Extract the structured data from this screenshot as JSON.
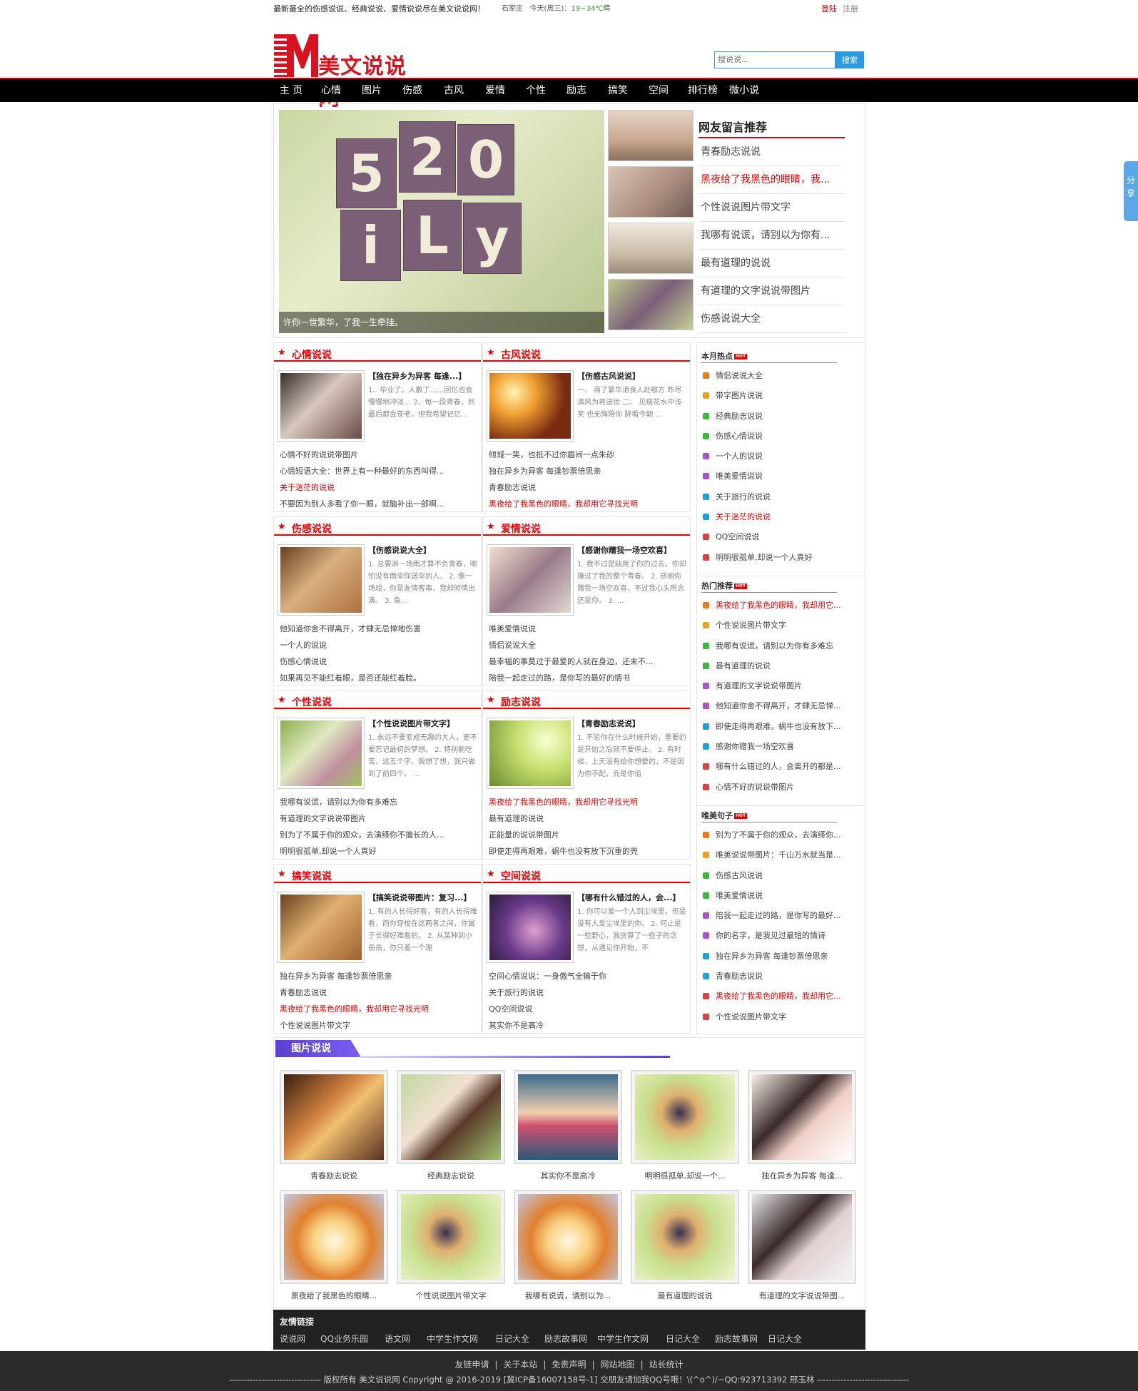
{
  "topbar": {
    "slogan": "最新最全的伤感说说、经典说说、爱情说说尽在美文说说网！",
    "city": "石家庄",
    "weather": "今天(周三)：",
    "temp": "19~34℃",
    "weather_tail": "晴",
    "login": "登陆",
    "register": "注册"
  },
  "logo": {
    "text": "美文说说网"
  },
  "search": {
    "placeholder": "搜说说...",
    "button": "搜索"
  },
  "nav": [
    "主 页",
    "心情",
    "图片",
    "伤感",
    "古风",
    "爱情",
    "个性",
    "励志",
    "搞笑",
    "空间",
    "排行榜",
    "微小说"
  ],
  "slider": {
    "caption": "许你一世繁华，了我一生牵挂。",
    "blocks": [
      "5",
      "2",
      "0",
      "i",
      "L",
      "y"
    ]
  },
  "recommend": {
    "title": "网友留言推荐",
    "items": [
      {
        "text": "青春励志说说",
        "red": false
      },
      {
        "text": "黑夜给了我黑色的眼睛，我...",
        "red": true
      },
      {
        "text": "个性说说图片带文字",
        "red": false
      },
      {
        "text": "我哪有说谎，请别以为你有...",
        "red": false
      },
      {
        "text": "最有道理的说说",
        "red": false
      },
      {
        "text": "有道理的文字说说带图片",
        "red": false
      },
      {
        "text": "伤感说说大全",
        "red": false
      }
    ]
  },
  "categories": [
    {
      "title": "心情说说",
      "head": "【独在异乡为异客 每逢...】",
      "excerpt": "1、毕业了，人散了……回忆也会慢慢地冲淡… 2、每一段青春，到最后都会苍老，但我希望记忆...",
      "items": [
        {
          "t": "心情不好的说说带图片",
          "r": false
        },
        {
          "t": "心情短语大全：世界上有一种最好的东西叫得...",
          "r": false
        },
        {
          "t": "关于迷茫的说说",
          "r": true
        },
        {
          "t": "不要因为别人多看了你一眼，就脑补出一部啊...",
          "r": false
        }
      ]
    },
    {
      "title": "古风说说",
      "head": "【伤感古风说说】",
      "excerpt": "一、 商了繁华泪良人赴哪方 昨尽清风为君送妆 二、 见瘦花水中浅笑 也无悔陪你 醉看今朝 ...",
      "items": [
        {
          "t": "倾城一笑，也抵不过你眉间一点朱砂",
          "r": false
        },
        {
          "t": "独在异乡为异客 每逢钞票倍思亲",
          "r": false
        },
        {
          "t": "青春励志说说",
          "r": false
        },
        {
          "t": "黑夜给了我黑色的眼睛，我却用它寻找光明",
          "r": true
        }
      ]
    },
    {
      "title": "伤感说说",
      "head": "【伤感说说大全】",
      "excerpt": "1. 总要淋一场雨才算不负青春，哪怕没有雨伞你送伞的人。 2. 像一场戏，你是友情客串，我却倾情出演。 3. 鱼...",
      "items": [
        {
          "t": "他知道你舍不得离开，才肆无忌惮地伤害",
          "r": false
        },
        {
          "t": "一个人的说说",
          "r": false
        },
        {
          "t": "伤感心情说说",
          "r": false
        },
        {
          "t": "如果再见不能红着眼，是否还能红着脸。",
          "r": false
        }
      ]
    },
    {
      "title": "爱情说说",
      "head": "【感谢你赠我一场空欢喜】",
      "excerpt": "1. 我不过是缺席了你的过去，你却撞过了我的整个青春。 2. 感谢你赠我一场空欢喜，不过我心头所念还是你。 3. ...",
      "items": [
        {
          "t": "唯美爱情说说",
          "r": false
        },
        {
          "t": "情侣说说大全",
          "r": false
        },
        {
          "t": "最幸福的事莫过于最爱的人就在身边，还未不...",
          "r": false
        },
        {
          "t": "陪我一起走过的路，是你写的最好的情书",
          "r": false
        }
      ]
    },
    {
      "title": "个性说说",
      "head": "【个性说说图片带文字】",
      "excerpt": "1. 永远不要变成无趣的大人，更不要忘记最初的梦想。 2. 特别能吃苦，这五个字，我想了想，我只做到了前四个。 ...",
      "items": [
        {
          "t": "我哪有说谎，请别以为你有多难忘",
          "r": false
        },
        {
          "t": "有道理的文字说说带图片",
          "r": false
        },
        {
          "t": "别为了不属于你的观众，去演绎你不擅长的人...",
          "r": false
        },
        {
          "t": "明明很孤单,却说一个人真好",
          "r": false
        }
      ]
    },
    {
      "title": "励志说说",
      "head": "【青春励志说说】",
      "excerpt": "1. 不论你在什么时候开始，重要的是开始之后就不要停止。 2. 有时候，上天没有给你想要的，不是因为你不配，而是你值",
      "items": [
        {
          "t": "黑夜给了我黑色的眼睛，我却用它寻找光明",
          "r": true
        },
        {
          "t": "最有道理的说说",
          "r": false
        },
        {
          "t": "正能量的说说带图片",
          "r": false
        },
        {
          "t": "即使走得再艰难，蜗牛也没有放下沉重的壳",
          "r": false
        }
      ]
    },
    {
      "title": "搞笑说说",
      "head": "【搞笑说说带图片：复习...】",
      "excerpt": "1. 有的人长得好看，有的人长得难看，而你穿梭在这两者之间，你属于长得好难看的。 2. 从某种到小岳岳，你只差一个理",
      "items": [
        {
          "t": "独在异乡为异客 每逢钞票倍思亲",
          "r": false
        },
        {
          "t": "青春励志说说",
          "r": false
        },
        {
          "t": "黑夜给了我黑色的眼睛，我却用它寻找光明",
          "r": true
        },
        {
          "t": "个性说说图片带文字",
          "r": false
        }
      ]
    },
    {
      "title": "空间说说",
      "head": "【哪有什么错过的人，会...】",
      "excerpt": "1. 你可以爱一个人到尘埃里，但是没有人爱尘埃里的你。 2. 何止是一些野心，我贪算了一些子的念想，从遇见你开始，不",
      "items": [
        {
          "t": "空间心情说说：一身傲气全输于你",
          "r": false
        },
        {
          "t": "关于旅行的说说",
          "r": false
        },
        {
          "t": "QQ空间说说",
          "r": false
        },
        {
          "t": "其实你不是高冷",
          "r": false
        }
      ]
    }
  ],
  "sidebar": [
    {
      "title": "本月热点",
      "badge": "HOT",
      "items": [
        {
          "t": "情侣说说大全",
          "r": false
        },
        {
          "t": "带字图片说说",
          "r": false
        },
        {
          "t": "经典励志说说",
          "r": false
        },
        {
          "t": "伤感心情说说",
          "r": false
        },
        {
          "t": "一个人的说说",
          "r": false
        },
        {
          "t": "唯美爱情说说",
          "r": false
        },
        {
          "t": "关于旅行的说说",
          "r": false
        },
        {
          "t": "关于迷茫的说说",
          "r": true
        },
        {
          "t": "QQ空间说说",
          "r": false
        },
        {
          "t": "明明很孤单,却说一个人真好",
          "r": false
        }
      ]
    },
    {
      "title": "热门推荐",
      "badge": "HOT",
      "items": [
        {
          "t": "黑夜给了我黑色的眼睛，我却用它...",
          "r": true
        },
        {
          "t": "个性说说图片带文字",
          "r": false
        },
        {
          "t": "我哪有说谎，请别以为你有多难忘",
          "r": false
        },
        {
          "t": "最有道理的说说",
          "r": false
        },
        {
          "t": "有道理的文字说说带图片",
          "r": false
        },
        {
          "t": "他知道你舍不得离开，才肆无忌惮...",
          "r": false
        },
        {
          "t": "即使走得再艰难，蜗牛也没有放下...",
          "r": false
        },
        {
          "t": "感谢你赠我一场空欢喜",
          "r": false
        },
        {
          "t": "哪有什么错过的人，会离开的都是...",
          "r": false
        },
        {
          "t": "心情不好的说说带图片",
          "r": false
        }
      ]
    },
    {
      "title": "唯美句子",
      "badge": "HOT",
      "items": [
        {
          "t": "别为了不属于你的观众，去演绎你...",
          "r": false
        },
        {
          "t": "唯美说说带图片：千山万水就当是...",
          "r": false
        },
        {
          "t": "伤感古风说说",
          "r": false
        },
        {
          "t": "唯美爱情说说",
          "r": false
        },
        {
          "t": "陪我一起走过的路，是你写的最好...",
          "r": false
        },
        {
          "t": "你的名字，是我见过最短的情诗",
          "r": false
        },
        {
          "t": "独在异乡为异客 每逢钞票倍思亲",
          "r": false
        },
        {
          "t": "青春励志说说",
          "r": false
        },
        {
          "t": "黑夜给了我黑色的眼睛，我却用它...",
          "r": true
        },
        {
          "t": "个性说说图片带文字",
          "r": false
        }
      ]
    }
  ],
  "dot_colors": [
    "#f07a1a",
    "#f0a020",
    "#3cb93c",
    "#3cb93c",
    "#b050d0",
    "#b050d0",
    "#20a0e0",
    "#20a0e0",
    "#e04040",
    "#e04040"
  ],
  "photos": {
    "title": "图片说说",
    "items": [
      "青春励志说说",
      "经典励志说说",
      "其实你不是高冷",
      "明明很孤单,却说一个...",
      "独在异乡为异客 每逢...",
      "黑夜给了我黑色的眼睛...",
      "个性说说图片带文字",
      "我哪有说谎，请别以为...",
      "最有道理的说说",
      "有道理的文字说说带图..."
    ]
  },
  "links": {
    "title": "友情链接",
    "items": [
      "说说网",
      "QQ业务乐园",
      "语文网",
      "中学生作文网",
      "日记大全",
      "励志故事网",
      "中学生作文网",
      "日记大全",
      "励志故事网",
      "日记大全"
    ]
  },
  "footer": {
    "links": [
      "友链申请",
      "关于本站",
      "免责声明",
      "网站地图",
      "站长统计"
    ],
    "separator": "|",
    "copyright": "------------------------------- 版权所有 美文说说网 Copyright @ 2016-2019 [冀ICP备16007158号-1] 交朋友请加我QQ号哦！\\(^o^)/~QQ:923713392 邢玉林 -------------------------------"
  },
  "share": {
    "label": "分享"
  }
}
